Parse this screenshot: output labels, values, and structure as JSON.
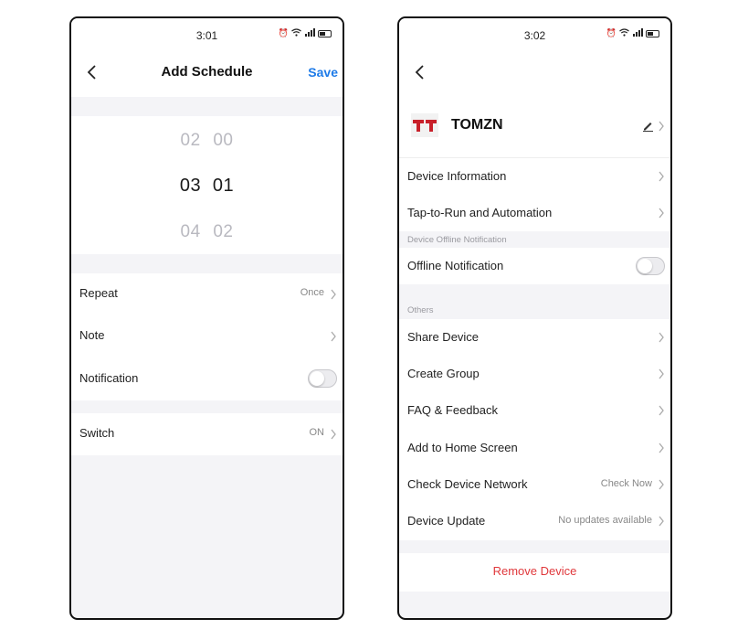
{
  "left": {
    "time": "3:01",
    "title": "Add Schedule",
    "save_label": "Save",
    "picker": {
      "rows": [
        {
          "hour": "02",
          "minute": "00",
          "selected": false
        },
        {
          "hour": "03",
          "minute": "01",
          "selected": true
        },
        {
          "hour": "04",
          "minute": "02",
          "selected": false
        }
      ]
    },
    "repeat": {
      "label": "Repeat",
      "value": "Once"
    },
    "note": {
      "label": "Note"
    },
    "notification": {
      "label": "Notification",
      "enabled": false
    },
    "switch": {
      "label": "Switch",
      "value": "ON"
    }
  },
  "right": {
    "time": "3:02",
    "device_name": "TOMZN",
    "items": {
      "device_information": "Device Information",
      "tap_to_run": "Tap-to-Run and Automation",
      "offline_section": "Device Offline Notification",
      "offline_notification": "Offline Notification",
      "others_section": "Others",
      "share_device": "Share Device",
      "create_group": "Create Group",
      "faq": "FAQ & Feedback",
      "add_home": "Add to Home Screen",
      "check_network": "Check Device Network",
      "check_network_value": "Check Now",
      "device_update": "Device Update",
      "device_update_value": "No updates available",
      "remove_device": "Remove Device"
    },
    "offline_enabled": false
  },
  "status_icons": [
    "alarm-icon",
    "wifi-icon",
    "signal-icon",
    "battery-icon"
  ],
  "colors": {
    "accent": "#1e7be8",
    "danger": "#e0383c",
    "logo": "#c8202a"
  }
}
